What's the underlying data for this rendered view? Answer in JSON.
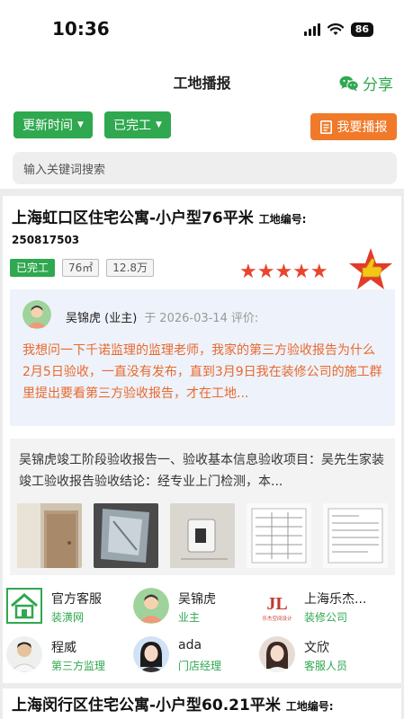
{
  "status_bar": {
    "time": "10:36",
    "battery": "86"
  },
  "nav": {
    "title": "工地播报",
    "share_label": "分享"
  },
  "filters": {
    "sort_label": "更新时间",
    "stage_label": "已完工",
    "report_label": "我要播报"
  },
  "search": {
    "placeholder": "输入关键词搜索"
  },
  "project": {
    "title": "上海虹口区住宅公寓-小户型76平米",
    "code_label": "工地编号:",
    "code": "250817503",
    "tags": [
      "已完工",
      "76㎡",
      "12.8万"
    ],
    "rating": 5,
    "star_glyph": "★★★★★"
  },
  "review": {
    "reviewer": "吴锦虎 (业主)",
    "at": "于",
    "date": "2026-03-14",
    "label": "评价:",
    "text": "我想问一下千诺监理的监理老师，我家的第三方验收报告为什么2月5日验收，一直没有发布，直到3月9日我在装修公司的施工群里提出要看第三方验收报告，才在工地..."
  },
  "report": {
    "text": "吴锦虎竣工阶段验收报告一、验收基本信息验收项目：吴先生家装竣工验收报告验收结论：经专业上门检测，本..."
  },
  "team": [
    {
      "name": "官方客服",
      "role": "装潢网",
      "icon": "house-logo-icon"
    },
    {
      "name": "吴锦虎",
      "role": "业主",
      "icon": "user-avatar-icon"
    },
    {
      "name": "上海乐杰...",
      "role": "装修公司",
      "icon": "company-logo-icon",
      "logo_text": "JL",
      "logo_sub": "乐杰空间设计"
    },
    {
      "name": "程威",
      "role": "第三方监理",
      "icon": "supervisor-avatar-icon"
    },
    {
      "name": "ada",
      "role": "门店经理",
      "icon": "manager-avatar-icon"
    },
    {
      "name": "文欣",
      "role": "客服人员",
      "icon": "service-avatar-icon"
    }
  ],
  "next_project": {
    "title": "上海闵行区住宅公寓-小户型60.21平米",
    "code_label": "工地编号:"
  },
  "colors": {
    "green": "#2fa84f",
    "orange": "#f07a2a",
    "star": "#e8452c",
    "review_text": "#e8692f"
  }
}
